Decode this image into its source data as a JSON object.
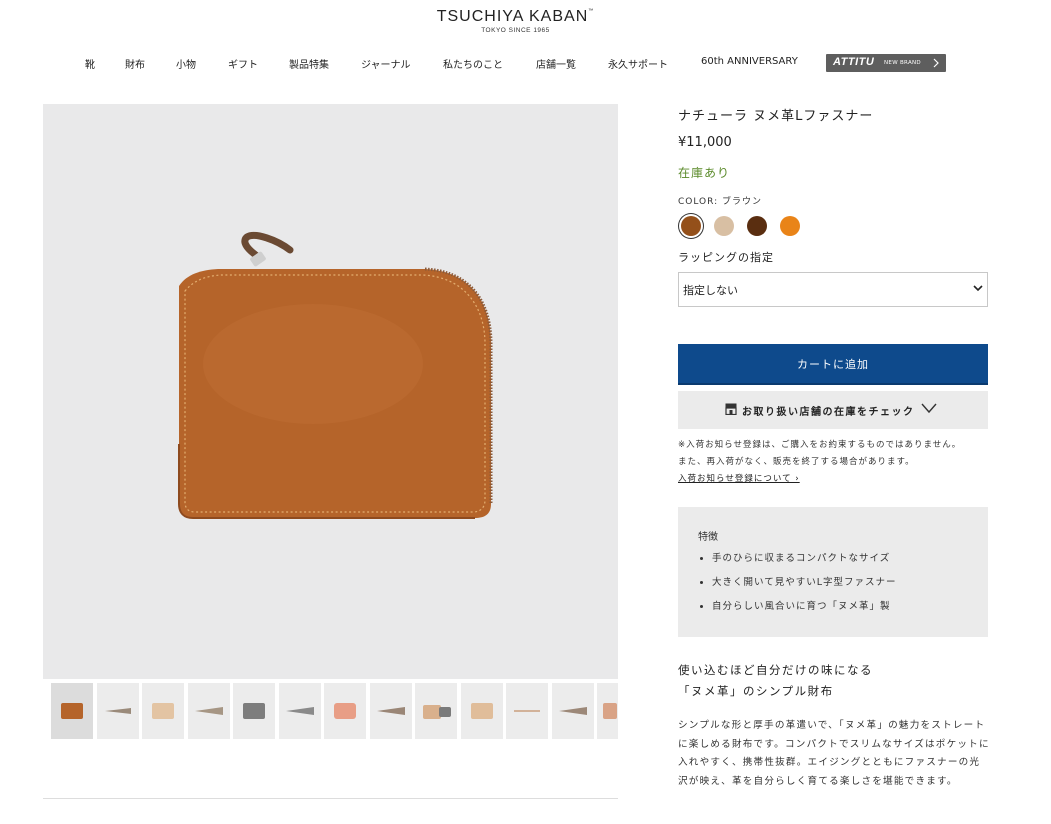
{
  "header": {
    "brand_main": "TSUCHIYA KABAN",
    "brand_tm": "™",
    "brand_sub": "TOKYO SINCE 1965"
  },
  "nav": {
    "items": [
      "靴",
      "財布",
      "小物",
      "ギフト",
      "製品特集",
      "ジャーナル",
      "私たちのこと",
      "店舗一覧",
      "永久サポート",
      "60th ANNIVERSARY"
    ],
    "brand_name": "ATTITU",
    "brand_tag": "NEW BRAND"
  },
  "product": {
    "title": "ナチューラ ヌメ革Lファスナー",
    "price": "¥11,000",
    "stock_status": "在庫あり",
    "color_label": "COLOR: ブラウン",
    "swatches": [
      {
        "name": "ブラウン",
        "color": "#94501a",
        "selected": true
      },
      {
        "name": "ベージュ",
        "color": "#d8bfa3",
        "selected": false
      },
      {
        "name": "ダークブラウン",
        "color": "#5a2e10",
        "selected": false
      },
      {
        "name": "オレンジ",
        "color": "#e98418",
        "selected": false
      }
    ],
    "wrapping_label": "ラッピングの指定",
    "wrapping_value": "指定しない",
    "cart_button": "カートに追加",
    "store_stock_button": "お取り扱い店舗の在庫をチェック",
    "notice_line1": "※入荷お知らせ登録は、ご購入をお約束するものではありません。",
    "notice_line2": "また、再入荷がなく、販売を終了する場合があります。",
    "notice_link": "入荷お知らせ登録について ›",
    "features_heading": "特徴",
    "features": [
      "手のひらに収まるコンパクトなサイズ",
      "大きく開いて見やすいL字型ファスナー",
      "自分らしい風合いに育つ「ヌメ革」製"
    ],
    "catch_line1": "使い込むほど自分だけの味になる",
    "catch_line2": "「ヌメ革」のシンプル財布",
    "description": "シンプルな形と厚手の革遣いで、「ヌメ革」の魅力をストレートに楽しめる財布です。コンパクトでスリムなサイズはポケットに入れやすく、携帯性抜群。エイジングとともにファスナーの光沢が映え、革を自分らしく育てる楽しさを堪能できます。"
  },
  "colors": {
    "accent_blue": "#0e4a8c",
    "stock_green": "#5a8a2a",
    "leather": "#b5642a"
  }
}
